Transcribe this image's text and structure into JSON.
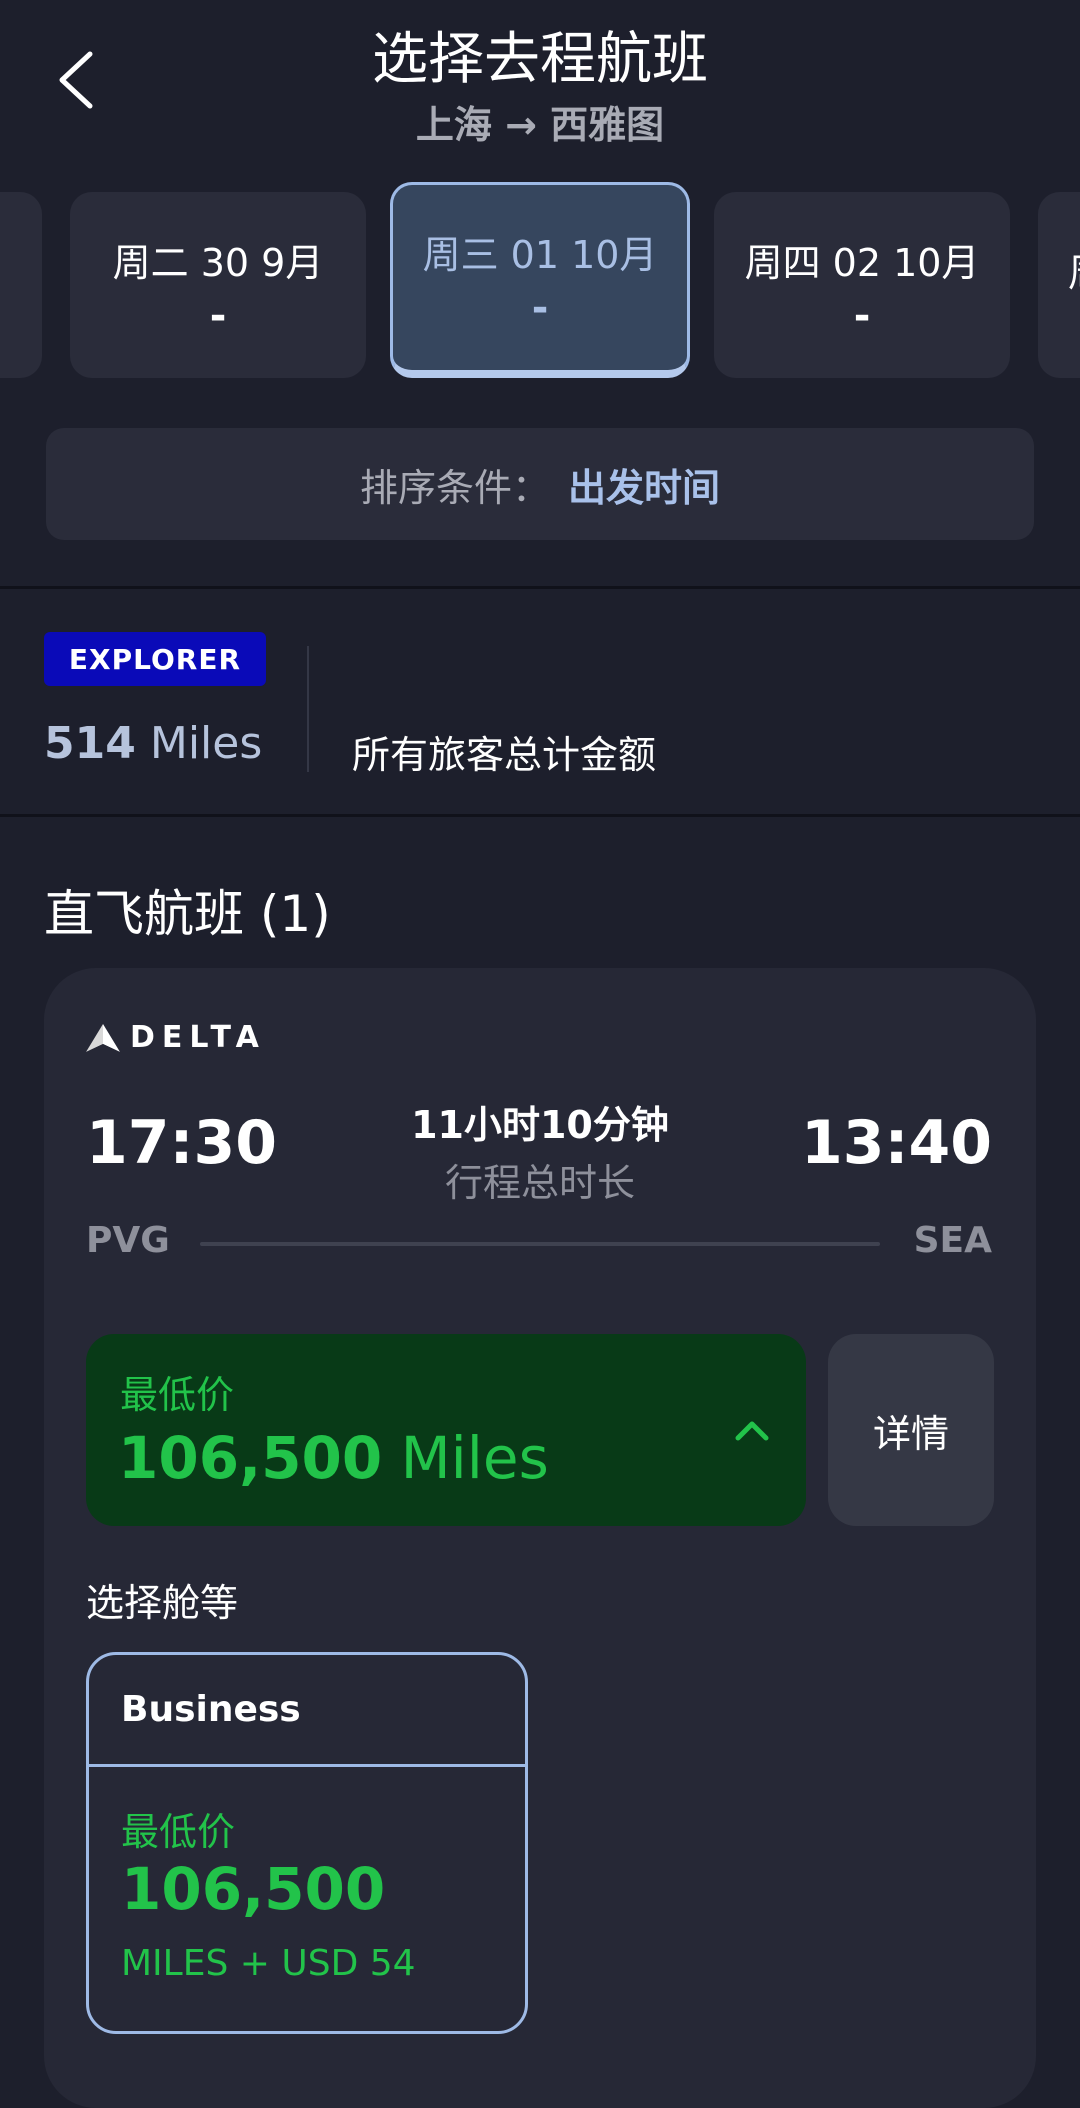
{
  "header": {
    "title": "选择去程航班",
    "route": "上海 → 西雅图"
  },
  "date_tabs": [
    {
      "label": "",
      "price": ""
    },
    {
      "label": "周二 30 9月",
      "price": "-"
    },
    {
      "label": "周三 01 10月",
      "price": "-",
      "selected": true
    },
    {
      "label": "周四 02 10月",
      "price": "-"
    },
    {
      "label": "周",
      "price": ""
    }
  ],
  "sort": {
    "label": "排序条件：",
    "value": "出发时间"
  },
  "account": {
    "tier": "EXPLORER",
    "miles_number": "514",
    "miles_unit": "Miles",
    "total_label": "所有旅客总计金额"
  },
  "section": {
    "title": "直飞航班 (1)"
  },
  "flight": {
    "airline": "DELTA",
    "departure_time": "17:30",
    "arrival_time": "13:40",
    "duration": "11小时10分钟",
    "duration_label": "行程总时长",
    "origin": "PVG",
    "destination": "SEA",
    "lowest_label": "最低价",
    "lowest_miles": "106,500",
    "lowest_unit": "Miles",
    "details_label": "详情",
    "cabin_title": "选择舱等",
    "cabin": {
      "name": "Business",
      "lowest_label": "最低价",
      "miles": "106,500",
      "extra": "MILES + USD 54"
    }
  },
  "colors": {
    "background": "#1d1f2c",
    "card": "#262836",
    "accent_blue": "#9ebae6",
    "green": "#22c34a",
    "green_box": "#083a17",
    "explorer_badge": "#0a0ab8"
  },
  "icons": {
    "back": "chevron-left-icon",
    "expand": "chevron-up-icon",
    "airline_logo": "delta-widget-icon"
  }
}
